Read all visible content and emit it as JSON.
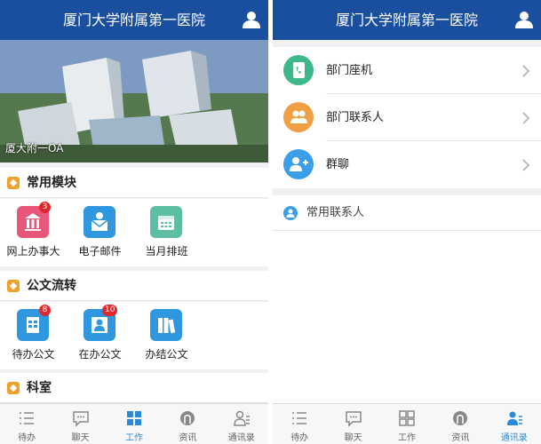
{
  "left": {
    "header": {
      "title": "厦门大学附属第一医院",
      "user_icon": "user-icon"
    },
    "banner": {
      "caption": "厦大附一OA"
    },
    "sections": [
      {
        "title": "常用模块",
        "items": [
          {
            "label": "网上办事大",
            "icon": "bank-icon",
            "color": "#e8567a",
            "badge": "3"
          },
          {
            "label": "电子邮件",
            "icon": "mail-person-icon",
            "color": "#2f96e0",
            "badge": ""
          },
          {
            "label": "当月排班",
            "icon": "calendar-icon",
            "color": "#5cbfa4",
            "badge": ""
          }
        ]
      },
      {
        "title": "公文流转",
        "items": [
          {
            "label": "待办公文",
            "icon": "document-icon",
            "color": "#2f96e0",
            "badge": "8"
          },
          {
            "label": "在办公文",
            "icon": "document-person-icon",
            "color": "#2f96e0",
            "badge": "10"
          },
          {
            "label": "办结公文",
            "icon": "books-icon",
            "color": "#2f96e0",
            "badge": ""
          }
        ]
      },
      {
        "title": "科室",
        "items": []
      }
    ],
    "tabbar": [
      {
        "label": "待办",
        "icon": "list-icon",
        "active": false
      },
      {
        "label": "聊天",
        "icon": "chat-icon",
        "active": false
      },
      {
        "label": "工作",
        "icon": "grid-icon",
        "active": true
      },
      {
        "label": "资讯",
        "icon": "news-icon",
        "active": false
      },
      {
        "label": "通讯录",
        "icon": "contacts-icon",
        "active": false
      }
    ]
  },
  "right": {
    "header": {
      "title": "厦门大学附属第一医院",
      "user_icon": "user-icon"
    },
    "list": [
      {
        "label": "部门座机",
        "icon": "phone-book-icon",
        "color": "#3cb88a"
      },
      {
        "label": "部门联系人",
        "icon": "people-icon",
        "color": "#f0a044"
      },
      {
        "label": "群聊",
        "icon": "group-add-icon",
        "color": "#3a9ee8"
      }
    ],
    "frequent": {
      "label": "常用联系人",
      "icon": "person-icon"
    },
    "tabbar": [
      {
        "label": "待办",
        "icon": "list-icon",
        "active": false
      },
      {
        "label": "聊天",
        "icon": "chat-icon",
        "active": false
      },
      {
        "label": "工作",
        "icon": "grid-icon",
        "active": false
      },
      {
        "label": "资讯",
        "icon": "news-icon",
        "active": false
      },
      {
        "label": "通讯录",
        "icon": "contacts-icon",
        "active": true
      }
    ]
  },
  "colors": {
    "header": "#1a4f9f",
    "accent": "#2a8ad8",
    "section_icon": "#f0a02c",
    "badge": "#e2262a"
  }
}
